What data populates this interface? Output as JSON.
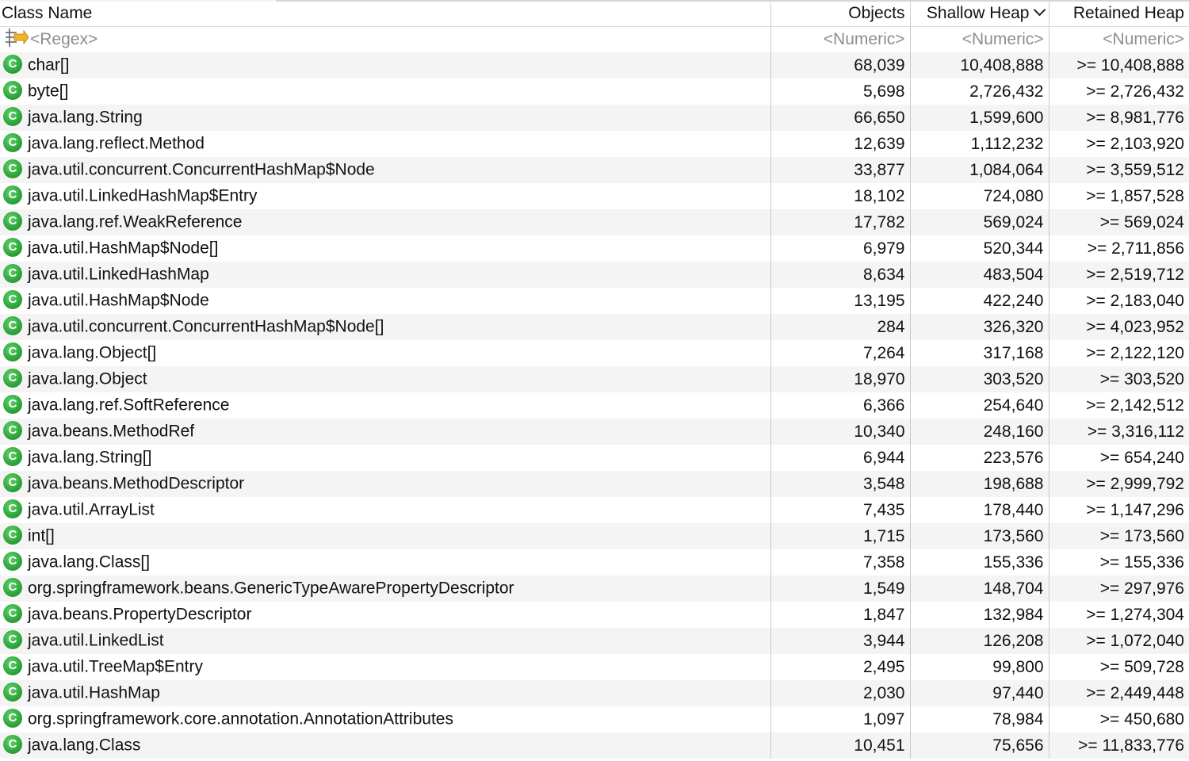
{
  "headers": {
    "class_name": "Class Name",
    "objects": "Objects",
    "shallow_heap": "Shallow Heap",
    "retained_heap": "Retained Heap"
  },
  "filter": {
    "class_name": "<Regex>",
    "objects": "<Numeric>",
    "shallow_heap": "<Numeric>",
    "retained_heap": "<Numeric>"
  },
  "rows": [
    {
      "name": "char[]",
      "objects": "68,039",
      "shallow": "10,408,888",
      "retained": ">= 10,408,888"
    },
    {
      "name": "byte[]",
      "objects": "5,698",
      "shallow": "2,726,432",
      "retained": ">= 2,726,432"
    },
    {
      "name": "java.lang.String",
      "objects": "66,650",
      "shallow": "1,599,600",
      "retained": ">= 8,981,776"
    },
    {
      "name": "java.lang.reflect.Method",
      "objects": "12,639",
      "shallow": "1,112,232",
      "retained": ">= 2,103,920"
    },
    {
      "name": "java.util.concurrent.ConcurrentHashMap$Node",
      "objects": "33,877",
      "shallow": "1,084,064",
      "retained": ">= 3,559,512"
    },
    {
      "name": "java.util.LinkedHashMap$Entry",
      "objects": "18,102",
      "shallow": "724,080",
      "retained": ">= 1,857,528"
    },
    {
      "name": "java.lang.ref.WeakReference",
      "objects": "17,782",
      "shallow": "569,024",
      "retained": ">= 569,024"
    },
    {
      "name": "java.util.HashMap$Node[]",
      "objects": "6,979",
      "shallow": "520,344",
      "retained": ">= 2,711,856"
    },
    {
      "name": "java.util.LinkedHashMap",
      "objects": "8,634",
      "shallow": "483,504",
      "retained": ">= 2,519,712"
    },
    {
      "name": "java.util.HashMap$Node",
      "objects": "13,195",
      "shallow": "422,240",
      "retained": ">= 2,183,040"
    },
    {
      "name": "java.util.concurrent.ConcurrentHashMap$Node[]",
      "objects": "284",
      "shallow": "326,320",
      "retained": ">= 4,023,952"
    },
    {
      "name": "java.lang.Object[]",
      "objects": "7,264",
      "shallow": "317,168",
      "retained": ">= 2,122,120"
    },
    {
      "name": "java.lang.Object",
      "objects": "18,970",
      "shallow": "303,520",
      "retained": ">= 303,520"
    },
    {
      "name": "java.lang.ref.SoftReference",
      "objects": "6,366",
      "shallow": "254,640",
      "retained": ">= 2,142,512"
    },
    {
      "name": "java.beans.MethodRef",
      "objects": "10,340",
      "shallow": "248,160",
      "retained": ">= 3,316,112"
    },
    {
      "name": "java.lang.String[]",
      "objects": "6,944",
      "shallow": "223,576",
      "retained": ">= 654,240"
    },
    {
      "name": "java.beans.MethodDescriptor",
      "objects": "3,548",
      "shallow": "198,688",
      "retained": ">= 2,999,792"
    },
    {
      "name": "java.util.ArrayList",
      "objects": "7,435",
      "shallow": "178,440",
      "retained": ">= 1,147,296"
    },
    {
      "name": "int[]",
      "objects": "1,715",
      "shallow": "173,560",
      "retained": ">= 173,560"
    },
    {
      "name": "java.lang.Class[]",
      "objects": "7,358",
      "shallow": "155,336",
      "retained": ">= 155,336"
    },
    {
      "name": "org.springframework.beans.GenericTypeAwarePropertyDescriptor",
      "objects": "1,549",
      "shallow": "148,704",
      "retained": ">= 297,976"
    },
    {
      "name": "java.beans.PropertyDescriptor",
      "objects": "1,847",
      "shallow": "132,984",
      "retained": ">= 1,274,304"
    },
    {
      "name": "java.util.LinkedList",
      "objects": "3,944",
      "shallow": "126,208",
      "retained": ">= 1,072,040"
    },
    {
      "name": "java.util.TreeMap$Entry",
      "objects": "2,495",
      "shallow": "99,800",
      "retained": ">= 509,728"
    },
    {
      "name": "java.util.HashMap",
      "objects": "2,030",
      "shallow": "97,440",
      "retained": ">= 2,449,448"
    },
    {
      "name": "org.springframework.core.annotation.AnnotationAttributes",
      "objects": "1,097",
      "shallow": "78,984",
      "retained": ">= 450,680"
    },
    {
      "name": "java.lang.Class",
      "objects": "10,451",
      "shallow": "75,656",
      "retained": ">= 11,833,776"
    }
  ],
  "icons": {
    "class_icon_glyph": "C",
    "class_icon_color": "#2ea43a",
    "filter_icon": "regex-filter-icon",
    "sort_icon": "chevron-down-icon"
  }
}
